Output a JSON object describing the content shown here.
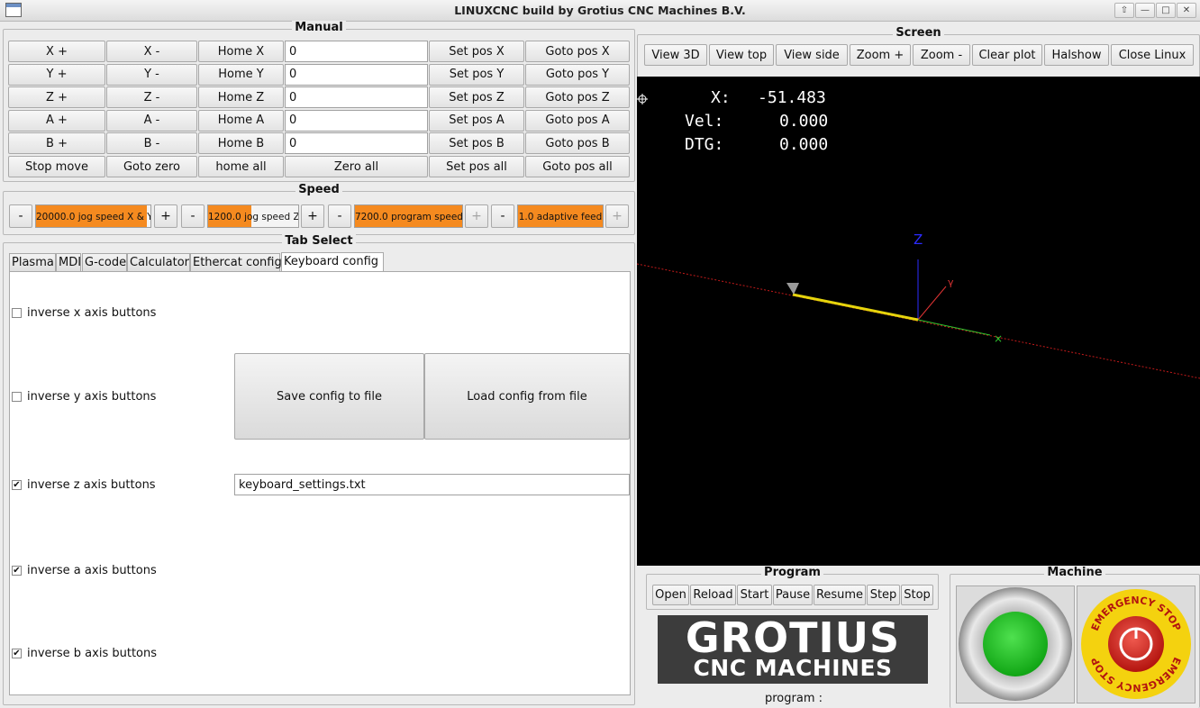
{
  "window": {
    "title": "LINUXCNC build by Grotius CNC Machines B.V."
  },
  "manual": {
    "title": "Manual",
    "rows": [
      {
        "plus": "X +",
        "minus": "X -",
        "home": "Home X",
        "value": "0",
        "set": "Set pos X",
        "goto": "Goto pos X"
      },
      {
        "plus": "Y +",
        "minus": "Y -",
        "home": "Home Y",
        "value": "0",
        "set": "Set pos Y",
        "goto": "Goto pos Y"
      },
      {
        "plus": "Z +",
        "minus": "Z -",
        "home": "Home Z",
        "value": "0",
        "set": "Set pos Z",
        "goto": "Goto pos Z"
      },
      {
        "plus": "A +",
        "minus": "A -",
        "home": "Home A",
        "value": "0",
        "set": "Set pos A",
        "goto": "Goto pos A"
      },
      {
        "plus": "B +",
        "minus": "B -",
        "home": "Home B",
        "value": "0",
        "set": "Set pos B",
        "goto": "Goto pos B"
      }
    ],
    "bottom": {
      "stop": "Stop move",
      "goto_zero": "Goto zero",
      "home_all": "home all",
      "zero_all": "Zero all",
      "set_all": "Set pos all",
      "goto_all": "Goto pos all"
    }
  },
  "speed": {
    "title": "Speed",
    "minus": "-",
    "plus": "+",
    "bars": [
      {
        "label": "20000.0 jog speed X & Y",
        "fill": 0.97
      },
      {
        "label": "1200.0 jog speed Z",
        "fill": 0.48
      },
      {
        "label": "7200.0 program speed",
        "fill": 1.0
      },
      {
        "label": "1.0 adaptive feed",
        "fill": 1.0
      }
    ]
  },
  "tabs": {
    "title": "Tab Select",
    "items": [
      "Plasma",
      "MDI",
      "G-code",
      "Calculator",
      "Ethercat config",
      "Keyboard config"
    ],
    "active": "Keyboard config"
  },
  "keyboard": {
    "checks": [
      {
        "label": "inverse x axis buttons",
        "checked": false
      },
      {
        "label": "inverse y axis buttons",
        "checked": false
      },
      {
        "label": "inverse z axis buttons",
        "checked": true
      },
      {
        "label": "inverse a axis buttons",
        "checked": true
      },
      {
        "label": "inverse b axis buttons",
        "checked": true
      }
    ],
    "save_label": "Save config to file",
    "load_label": "Load config from file",
    "filename": "keyboard_settings.txt"
  },
  "screen": {
    "title": "Screen",
    "buttons": [
      "View 3D",
      "View top",
      "View side",
      "Zoom +",
      "Zoom -",
      "Clear plot",
      "Halshow",
      "Close Linux"
    ],
    "dro": {
      "x_label": "X:",
      "x": "-51.483",
      "vel_label": "Vel:",
      "vel": "0.000",
      "dtg_label": "DTG:",
      "dtg": "0.000"
    },
    "axis_labels": {
      "z": "Z"
    }
  },
  "program": {
    "title": "Program",
    "buttons": [
      "Open",
      "Reload",
      "Start",
      "Pause",
      "Resume",
      "Step",
      "Stop"
    ],
    "status_label": "program :",
    "logo": {
      "line1": "GROTIUS",
      "line2": "CNC MACHINES"
    }
  },
  "machine": {
    "title": "Machine",
    "estop_text": "EMERGENCY STOP"
  },
  "colors": {
    "accent": "#f58a1f",
    "plot_bg": "#000000",
    "start_green": "#19c21d",
    "estop_yellow": "#f4d20f",
    "estop_red": "#d8231f"
  }
}
